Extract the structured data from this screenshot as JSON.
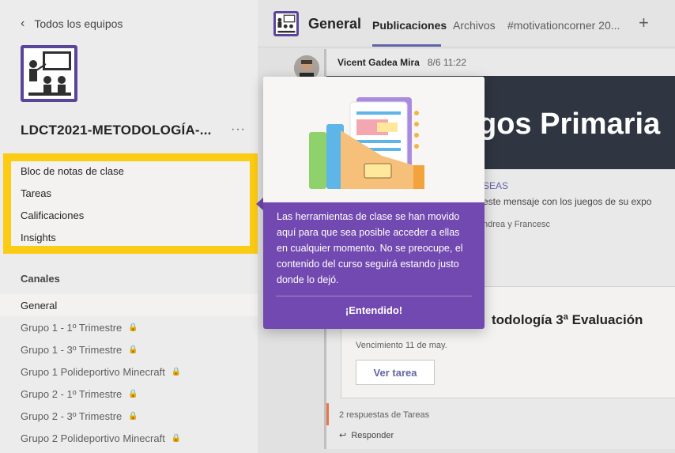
{
  "sidebar": {
    "back_label": "Todos los equipos",
    "team_name": "LDCT2021-METODOLOGÍA-...",
    "more_label": "···",
    "tools": [
      "Bloc de notas de clase",
      "Tareas",
      "Calificaciones",
      "Insights"
    ],
    "channels_title": "Canales",
    "channels": [
      {
        "name": "General",
        "locked": false,
        "active": true
      },
      {
        "name": "Grupo 1 - 1º Trimestre",
        "locked": true,
        "active": false
      },
      {
        "name": "Grupo 1 - 3º Trimestre",
        "locked": true,
        "active": false
      },
      {
        "name": "Grupo 1 Polideportivo Minecraft",
        "locked": true,
        "active": false
      },
      {
        "name": "Grupo 2 - 1º Trimestre",
        "locked": true,
        "active": false
      },
      {
        "name": "Grupo 2 - 3º Trimestre",
        "locked": true,
        "active": false
      },
      {
        "name": "Grupo 2 Polideportivo Minecraft",
        "locked": true,
        "active": false
      }
    ]
  },
  "header": {
    "channel_title": "General",
    "tabs": [
      "Publicaciones",
      "Archivos",
      "#motivationcorner 20..."
    ],
    "active_tab": "Publicaciones",
    "add_tab_label": "+"
  },
  "post": {
    "author": "Vicent Gadea Mira",
    "timestamp": "8/6 11:22",
    "banner_text": "gos Primaria",
    "line_1": "SEAS",
    "line_2": "este mensaje con los juegos de su expo",
    "line_3": "ndrea y Francesc"
  },
  "assignment": {
    "title": "todología 3ª Evaluación",
    "due": "Vencimiento 11 de may.",
    "button_label": "Ver tarea"
  },
  "replies": {
    "count_label": "2 respuestas de Tareas",
    "reply_label": "Responder"
  },
  "popover": {
    "message": "Las herramientas de clase se han movido aquí para que sea posible acceder a ellas en cualquier momento. No se preocupe, el contenido del curso seguirá estando justo donde lo dejó.",
    "button_label": "¡Entendido!"
  },
  "colors": {
    "highlight": "#fccb13",
    "popover": "#7249b0",
    "accent": "#6264a7",
    "team_logo": "#5b4599"
  }
}
